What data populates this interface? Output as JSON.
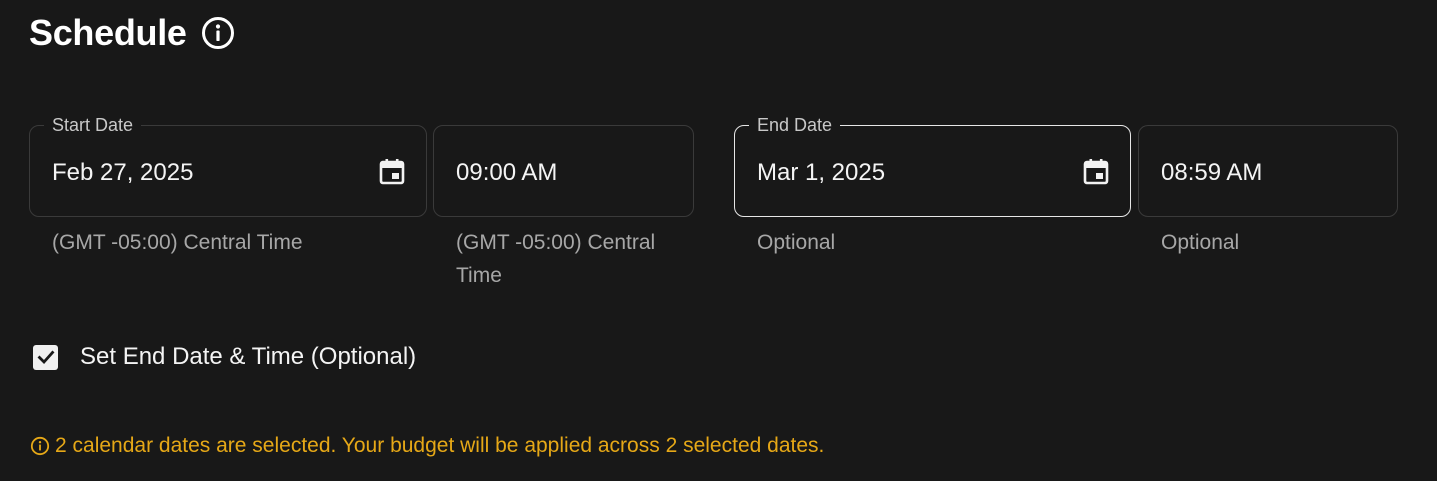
{
  "header": {
    "title": "Schedule",
    "info_icon": "info-circle-icon"
  },
  "start_date": {
    "label": "Start Date",
    "value": "Feb 27, 2025",
    "icon": "calendar-icon",
    "helper": "(GMT -05:00) Central Time"
  },
  "start_time": {
    "value": "09:00 AM",
    "helper_line1": "(GMT -05:00) Central",
    "helper_line2": "Time"
  },
  "end_date": {
    "label": "End Date",
    "value": "Mar 1, 2025",
    "icon": "calendar-icon",
    "helper": "Optional"
  },
  "end_time": {
    "value": "08:59 AM",
    "helper": "Optional"
  },
  "set_end": {
    "label": "Set End Date & Time (Optional)",
    "checked": true
  },
  "notice": {
    "text": "2 calendar dates are selected. Your budget will be applied across 2 selected dates.",
    "icon": "info-circle-icon",
    "color": "#e6a817"
  },
  "colors": {
    "background": "#181818",
    "border": "#3a3a3a",
    "border_active": "#e6e6e6",
    "helper_text": "#a7a7a7"
  }
}
